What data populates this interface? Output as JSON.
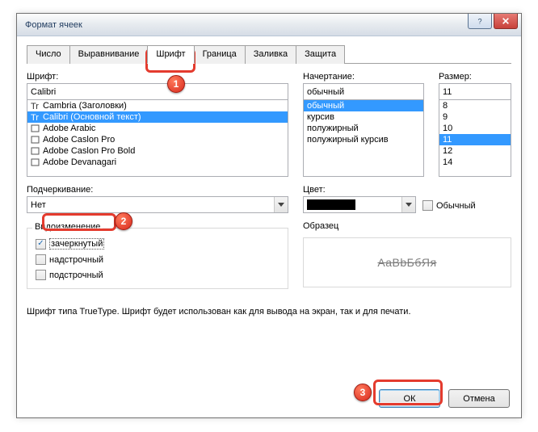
{
  "dialog_title": "Формат ячеек",
  "tabs": [
    "Число",
    "Выравнивание",
    "Шрифт",
    "Граница",
    "Заливка",
    "Защита"
  ],
  "active_tab_index": 2,
  "font": {
    "label": "Шрифт:",
    "value": "Calibri",
    "items": [
      "Cambria (Заголовки)",
      "Calibri (Основной текст)",
      "Adobe Arabic",
      "Adobe Caslon Pro",
      "Adobe Caslon Pro Bold",
      "Adobe Devanagari"
    ],
    "selected_index": 1
  },
  "style": {
    "label": "Начертание:",
    "value": "обычный",
    "items": [
      "обычный",
      "курсив",
      "полужирный",
      "полужирный курсив"
    ],
    "selected_index": 0
  },
  "size": {
    "label": "Размер:",
    "value": "11",
    "items": [
      "8",
      "9",
      "10",
      "11",
      "12",
      "14"
    ],
    "selected_index": 3
  },
  "underline": {
    "label": "Подчеркивание:",
    "value": "Нет"
  },
  "color": {
    "label": "Цвет:",
    "swatch": "#000000"
  },
  "normal_font": {
    "label": "Обычный",
    "checked": false
  },
  "effects": {
    "legend": "Видоизменение",
    "strike": {
      "label": "зачеркнутый",
      "checked": true
    },
    "super": {
      "label": "надстрочный",
      "checked": false
    },
    "sub": {
      "label": "подстрочный",
      "checked": false
    }
  },
  "sample": {
    "legend": "Образец",
    "text": "AaBbБбЯя"
  },
  "hint": "Шрифт типа TrueType. Шрифт будет использован как для вывода на экран, так и для печати.",
  "buttons": {
    "ok": "ОК",
    "cancel": "Отмена"
  },
  "badges": {
    "b1": "1",
    "b2": "2",
    "b3": "3"
  }
}
